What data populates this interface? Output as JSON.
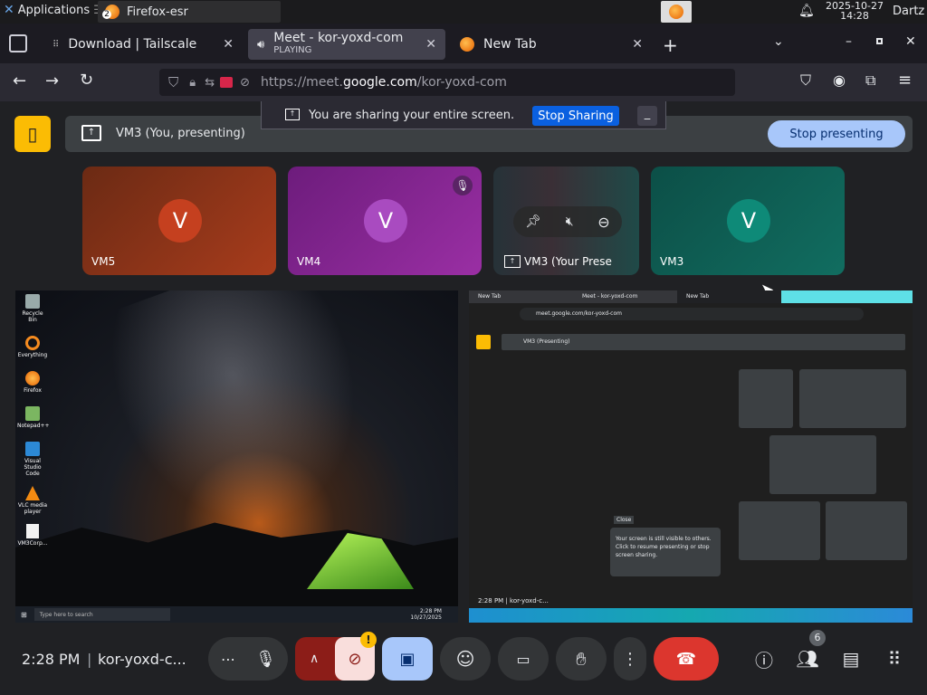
{
  "system_bar": {
    "applications_label": "Applications",
    "taskbar_item": "Firefox-esr",
    "taskbar_badge": "2",
    "clock_date": "2025-10-27",
    "clock_time": "14:28",
    "user": "Dartz"
  },
  "browser": {
    "tabs": [
      {
        "title": "Download | Tailscale",
        "subtitle": "",
        "active": false
      },
      {
        "title": "Meet - kor-yoxd-com",
        "subtitle": "PLAYING",
        "active": true
      },
      {
        "title": "New Tab",
        "subtitle": "",
        "active": false
      }
    ],
    "url_prefix": "https://meet.",
    "url_domain": "google.com",
    "url_path": "/kor-yoxd-com"
  },
  "meet": {
    "presenting_label": "VM3 (You, presenting)",
    "share_notice": "You are sharing your entire screen.",
    "stop_sharing_label": "Stop Sharing",
    "stop_presenting_label": "Stop presenting",
    "participants": [
      {
        "name": "VM5",
        "initial": "V",
        "color": "#c5401f",
        "muted": false
      },
      {
        "name": "VM4",
        "initial": "V",
        "color": "#a94bc0",
        "muted": true
      },
      {
        "name": "VM3 (Your Prese",
        "initial": "",
        "color": "",
        "muted": true
      },
      {
        "name": "VM3",
        "initial": "V",
        "color": "#0e8a78",
        "muted": false
      }
    ],
    "meeting_time": "2:28 PM",
    "meeting_code": "kor-yoxd-c...",
    "people_count": "6",
    "camera_warning": "!"
  },
  "desktop_preview": {
    "icons": [
      "Recycle Bin",
      "Everything",
      "Firefox",
      "Notepad++",
      "Visual Studio Code",
      "VLC media player",
      "VM3Corp..."
    ],
    "search_placeholder": "Type here to search",
    "tray_time": "2:28 PM",
    "tray_date": "10/27/2025"
  },
  "nested_preview": {
    "tabs": [
      "New Tab",
      "Meet - kor-yoxd-com",
      "New Tab"
    ],
    "url": "meet.google.com/kor-yoxd-com",
    "presenting": "VM3 (Presenting)",
    "tooltip_title": "Close",
    "tooltip_text": "Your screen is still visible to others. Click to resume presenting or stop screen sharing.",
    "time": "2:28 PM",
    "code": "kor-yoxd-c..."
  },
  "colors": {
    "accent_blue": "#a8c7fa",
    "end_call_red": "#dc362e",
    "meet_bg": "#202124",
    "control_gray": "#333537",
    "danger_dark": "#8c1d18"
  }
}
